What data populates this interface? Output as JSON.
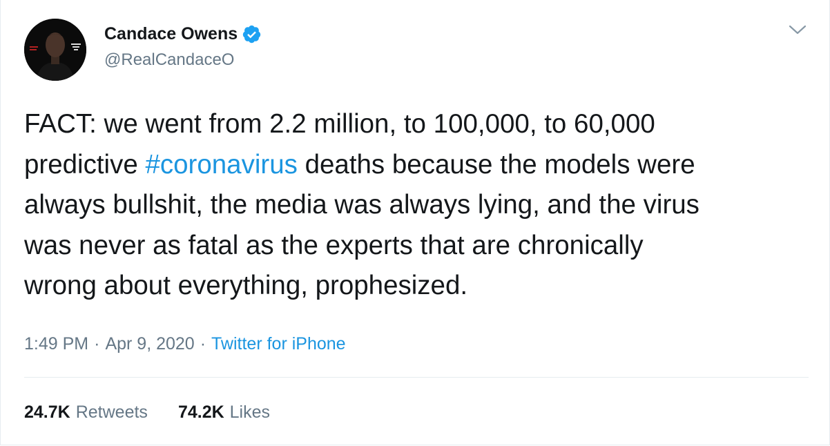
{
  "tweet": {
    "author": {
      "display_name": "Candace Owens",
      "handle": "@RealCandaceO",
      "verified": true,
      "avatar_icon": "profile-photo"
    },
    "menu_icon": "chevron-down-icon",
    "text_lines": [
      [
        {
          "text": "FACT: we went from 2.2 million, to 100,000, to 60,000"
        }
      ],
      [
        {
          "text": "predictive "
        },
        {
          "text": "#coronavirus",
          "hashtag": true
        },
        {
          "text": " deaths because the models were"
        }
      ],
      [
        {
          "text": "always bullshit, the media was always lying, and the virus"
        }
      ],
      [
        {
          "text": "was never as fatal as the experts that are chronically"
        }
      ],
      [
        {
          "text": "wrong about everything, prophesized."
        }
      ]
    ],
    "meta": {
      "time": "1:49 PM",
      "separator": "·",
      "date": "Apr 9, 2020",
      "source": "Twitter for iPhone"
    },
    "stats": {
      "retweets_count": "24.7K",
      "retweets_label": "Retweets",
      "likes_count": "74.2K",
      "likes_label": "Likes"
    }
  },
  "colors": {
    "text": "#14171a",
    "secondary": "#657786",
    "link": "#1b95e0",
    "verified_badge": "#1da1f2",
    "divider": "#e6ecf0"
  }
}
